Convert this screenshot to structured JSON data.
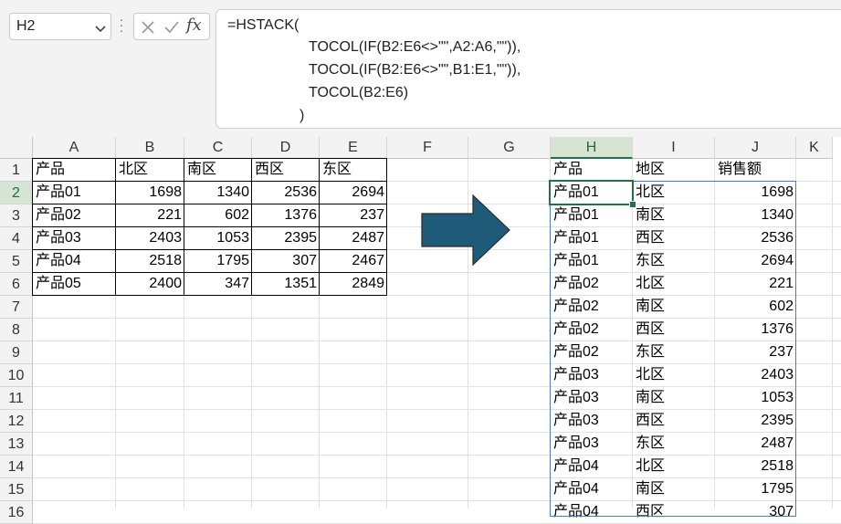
{
  "name_box": {
    "value": "H2"
  },
  "formula_bar": {
    "icons": [
      "cancel-icon",
      "enter-icon",
      "fx-icon"
    ],
    "fx_label": "fx",
    "lines": [
      "=HSTACK(",
      "TOCOL(IF(B2:E6<>\"\",A2:A6,\"\")),",
      "TOCOL(IF(B2:E6<>\"\",B1:E1,\"\")),",
      "TOCOL(B2:E6)",
      ")"
    ]
  },
  "columns": [
    "A",
    "B",
    "C",
    "D",
    "E",
    "F",
    "G",
    "H",
    "I",
    "J",
    "K"
  ],
  "rows": [
    "1",
    "2",
    "3",
    "4",
    "5",
    "6",
    "7",
    "8",
    "9",
    "10",
    "11",
    "12",
    "13",
    "14",
    "15",
    "16"
  ],
  "source_table": {
    "headers": [
      "产品",
      "北区",
      "南区",
      "西区",
      "东区"
    ],
    "rows": [
      [
        "产品01",
        "1698",
        "1340",
        "2536",
        "2694"
      ],
      [
        "产品02",
        "221",
        "602",
        "1376",
        "237"
      ],
      [
        "产品03",
        "2403",
        "1053",
        "2395",
        "2487"
      ],
      [
        "产品04",
        "2518",
        "1795",
        "307",
        "2467"
      ],
      [
        "产品05",
        "2400",
        "347",
        "1351",
        "2849"
      ]
    ]
  },
  "result_table": {
    "headers": [
      "产品",
      "地区",
      "销售额"
    ],
    "rows": [
      [
        "产品01",
        "北区",
        "1698"
      ],
      [
        "产品01",
        "南区",
        "1340"
      ],
      [
        "产品01",
        "西区",
        "2536"
      ],
      [
        "产品01",
        "东区",
        "2694"
      ],
      [
        "产品02",
        "北区",
        "221"
      ],
      [
        "产品02",
        "南区",
        "602"
      ],
      [
        "产品02",
        "西区",
        "1376"
      ],
      [
        "产品02",
        "东区",
        "237"
      ],
      [
        "产品03",
        "北区",
        "2403"
      ],
      [
        "产品03",
        "南区",
        "1053"
      ],
      [
        "产品03",
        "西区",
        "2395"
      ],
      [
        "产品03",
        "东区",
        "2487"
      ],
      [
        "产品04",
        "北区",
        "2518"
      ],
      [
        "产品04",
        "南区",
        "1795"
      ],
      [
        "产品04",
        "西区",
        "307"
      ]
    ]
  },
  "arrow": {
    "icon": "right-arrow-icon",
    "color": "#1f5a78"
  },
  "colors": {
    "selection": "#217346",
    "spill_border": "#4a7ebb"
  }
}
